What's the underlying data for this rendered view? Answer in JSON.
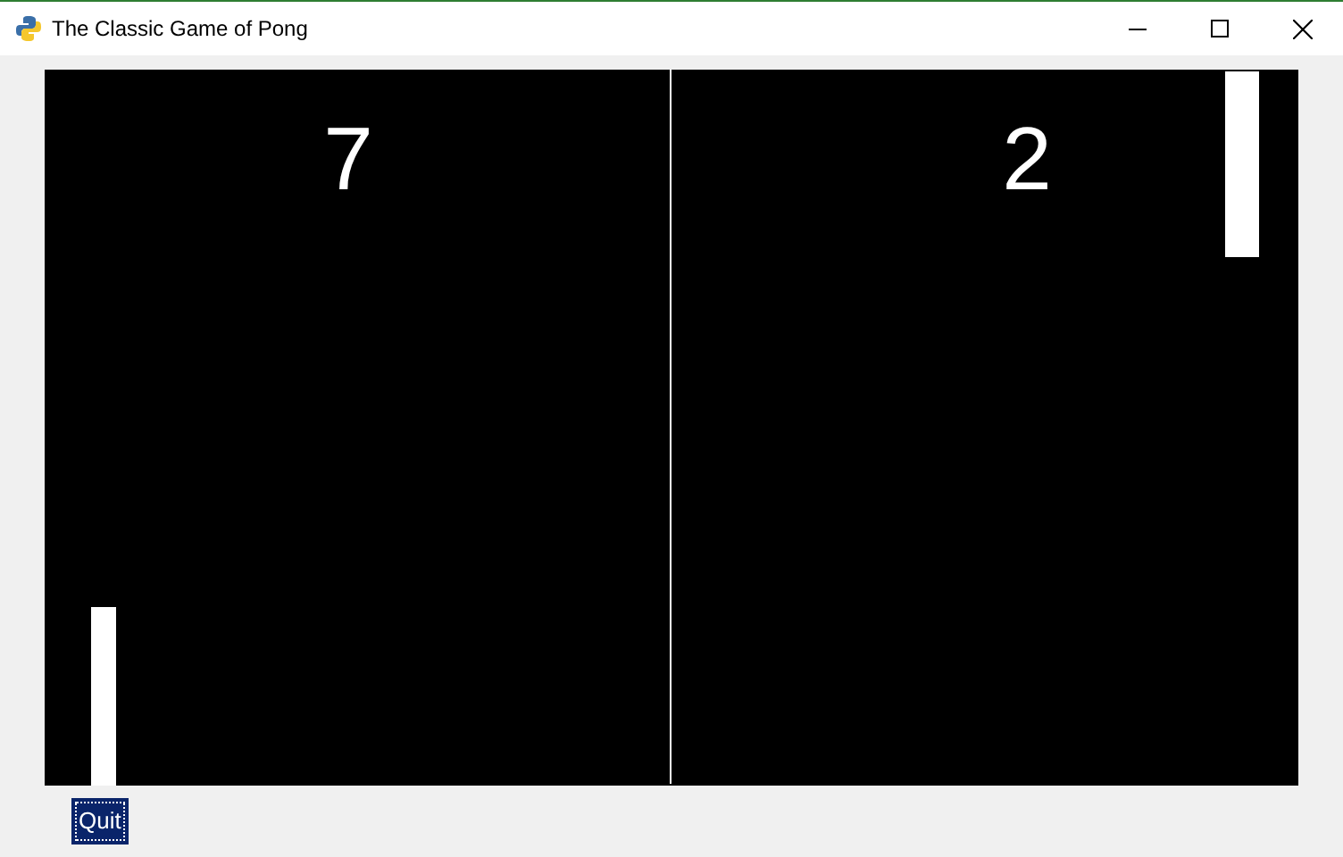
{
  "window": {
    "title": "The Classic Game of Pong"
  },
  "scores": [
    {
      "value": "7"
    },
    {
      "value": "2"
    }
  ],
  "quit_button": {
    "label": "Quit",
    "focused": true
  }
}
